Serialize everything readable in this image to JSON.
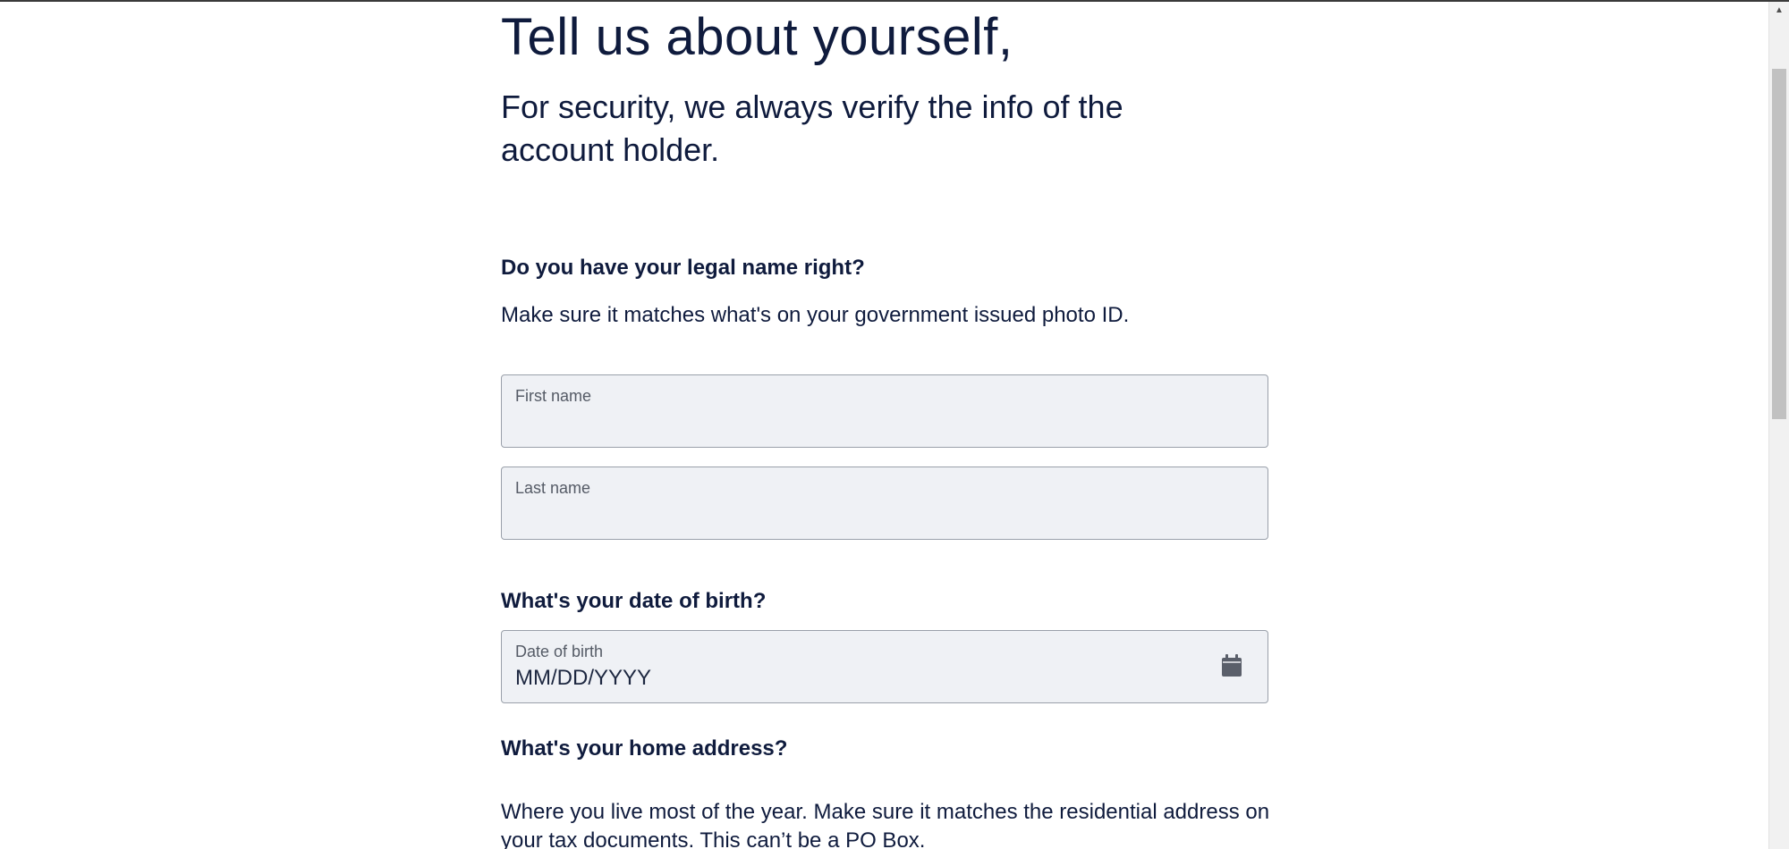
{
  "header": {
    "title": "Tell us about yourself,",
    "subtitle": "For security, we always verify the info of the account holder."
  },
  "legal_name": {
    "heading": "Do you have your legal name right?",
    "help": "Make sure it matches what's on your government issued photo ID.",
    "first_name": {
      "label": "First name",
      "value": ""
    },
    "last_name": {
      "label": "Last name",
      "value": ""
    }
  },
  "dob": {
    "heading": "What's your date of birth?",
    "label": "Date of birth",
    "placeholder": "MM/DD/YYYY",
    "value": "",
    "icon": "calendar-icon"
  },
  "address": {
    "heading": "What's your home address?",
    "help": "Where you live most of the year. Make sure it matches the residential address on your tax documents. This can’t be a PO Box."
  },
  "colors": {
    "text": "#0f1b3d",
    "field_bg": "#eff1f5",
    "field_border": "#9aa0aa"
  }
}
